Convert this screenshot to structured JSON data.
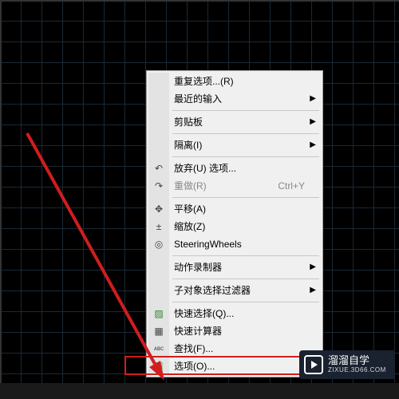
{
  "menu": {
    "items": [
      {
        "label": "重复选项...(R)",
        "icon": "",
        "submenu": false
      },
      {
        "label": "最近的输入",
        "icon": "",
        "submenu": true
      },
      {
        "sep": true
      },
      {
        "label": "剪贴板",
        "icon": "",
        "submenu": true
      },
      {
        "sep": true
      },
      {
        "label": "隔离(I)",
        "icon": "",
        "submenu": true
      },
      {
        "sep": true
      },
      {
        "label": "放弃(U) 选项...",
        "icon": "undo",
        "submenu": false
      },
      {
        "label": "重做(R)",
        "icon": "redo",
        "submenu": false,
        "disabled": true,
        "shortcut": "Ctrl+Y"
      },
      {
        "sep": true
      },
      {
        "label": "平移(A)",
        "icon": "pan",
        "submenu": false
      },
      {
        "label": "缩放(Z)",
        "icon": "zoom",
        "submenu": false
      },
      {
        "label": "SteeringWheels",
        "icon": "wheel",
        "submenu": false
      },
      {
        "sep": true
      },
      {
        "label": "动作录制器",
        "icon": "",
        "submenu": true
      },
      {
        "sep": true
      },
      {
        "label": "子对象选择过滤器",
        "icon": "",
        "submenu": true
      },
      {
        "sep": true
      },
      {
        "label": "快速选择(Q)...",
        "icon": "qselect",
        "submenu": false
      },
      {
        "label": "快速计算器",
        "icon": "calc",
        "submenu": false
      },
      {
        "label": "查找(F)...",
        "icon": "find",
        "submenu": false
      },
      {
        "label": "选项(O)...",
        "icon": "options",
        "submenu": false
      }
    ]
  },
  "watermark": {
    "title": "溜溜自学",
    "sub": "ZIXUE.3D66.COM"
  },
  "icons": {
    "undo": "↶",
    "redo": "↷",
    "pan": "✥",
    "zoom": "±",
    "wheel": "◎",
    "qselect": "▨",
    "calc": "▦",
    "find": "ᴀʙᴄ",
    "options": "☑"
  },
  "annotation": {
    "highlight_target": "选项(O)..."
  }
}
